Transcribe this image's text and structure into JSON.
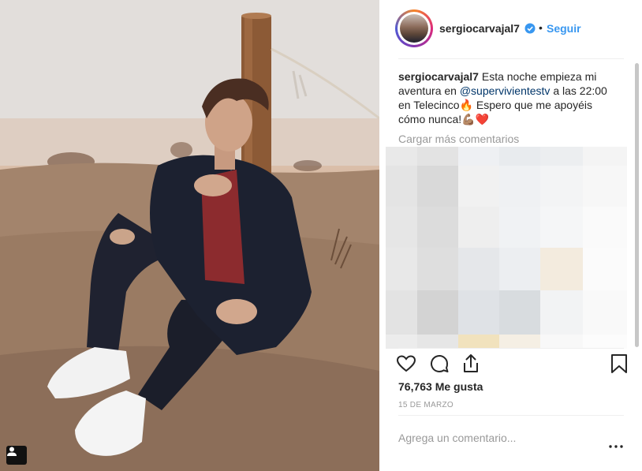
{
  "post": {
    "username": "sergiocarvajal7",
    "verified": true,
    "separator": "•",
    "follow_label": "Seguir",
    "caption": {
      "username": "sergiocarvajal7",
      "text_before_mention": "Esta noche empieza mi aventura en ",
      "mention": "@supervivientestv",
      "text_after_mention": " a las 22:00 en Telecinco",
      "emoji_fire": "🔥",
      "text_tail": " Espero que me apoyéis cómo nunca!",
      "emoji_muscle": "💪🏽",
      "emoji_heart": "❤️"
    },
    "load_more_label": "Cargar más comentarios",
    "likes_count": "76,763",
    "likes_label": "Me gusta",
    "date": "15 DE MARZO",
    "comment_placeholder": "Agrega un comentario...",
    "more_options": "..."
  },
  "icons": {
    "like": "heart-icon",
    "comment": "comment-icon",
    "share": "share-icon",
    "save": "bookmark-icon",
    "verified": "verified-badge-icon",
    "user_tag": "user-tag-icon"
  },
  "colors": {
    "link_blue": "#3897f0",
    "mention_blue": "#003569",
    "text": "#262626",
    "muted": "#999999",
    "verified_blue": "#3897f0"
  }
}
